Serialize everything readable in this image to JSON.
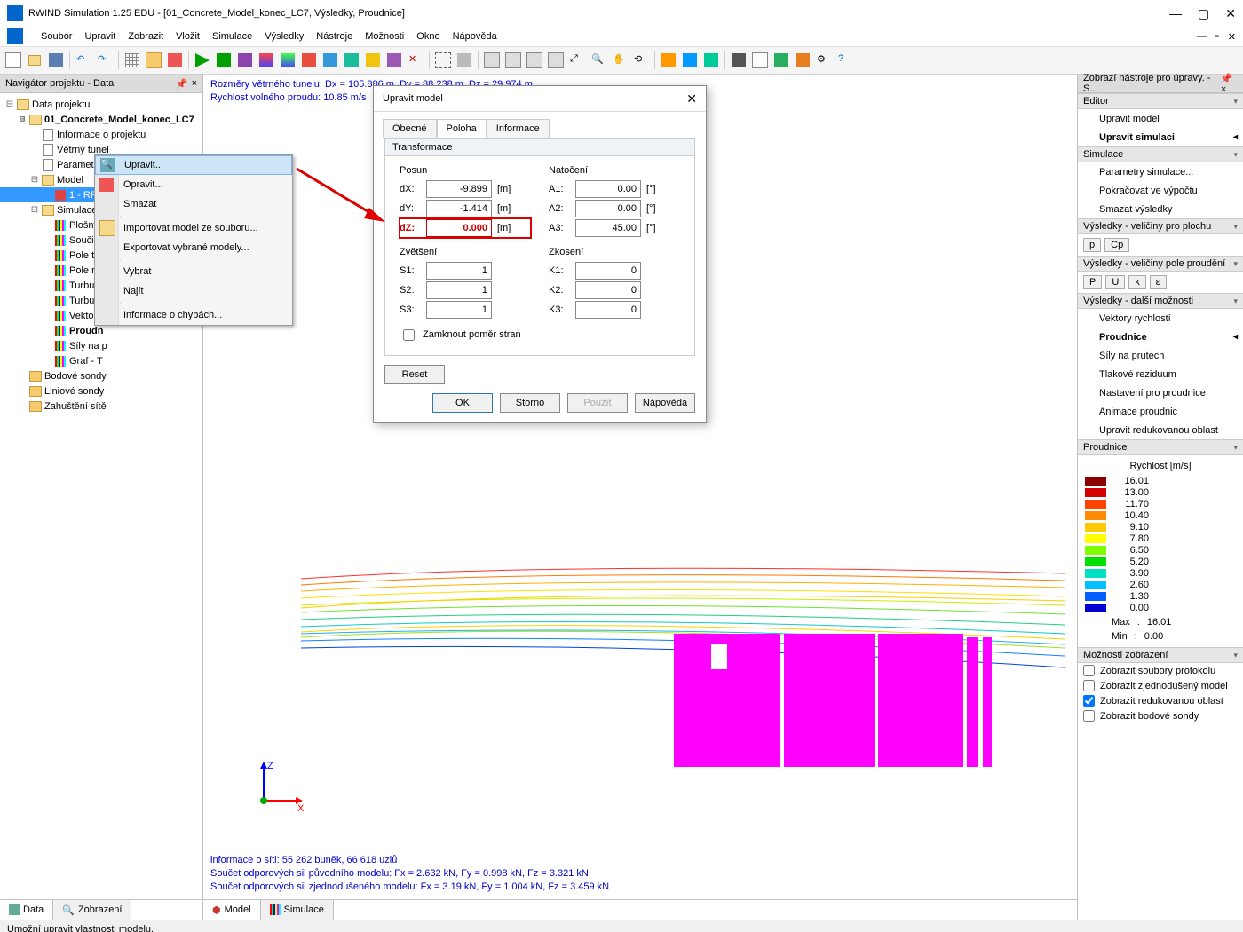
{
  "title": "RWIND Simulation 1.25 EDU - [01_Concrete_Model_konec_LC7, Výsledky, Proudnice]",
  "menu": [
    "Soubor",
    "Upravit",
    "Zobrazit",
    "Vložit",
    "Simulace",
    "Výsledky",
    "Nástroje",
    "Možnosti",
    "Okno",
    "Nápověda"
  ],
  "leftPanel": {
    "title": "Navigátor projektu - Data"
  },
  "tree": {
    "root": "Data projektu",
    "project": "01_Concrete_Model_konec_LC7",
    "items": [
      "Informace o projektu",
      "Větrný tunel",
      "Parametry simulace"
    ],
    "model": "Model",
    "modelSel": "1 - RFE",
    "sim": "Simulace",
    "simItems": [
      "Plošný r",
      "Součinit",
      "Pole tla",
      "Pole ryc",
      "Turbule",
      "Turbule",
      "Vektory",
      "Proudn",
      "Síly na p",
      "Graf - T"
    ],
    "tail": [
      "Bodové sondy",
      "Liniové sondy",
      "Zahuštění sítě"
    ]
  },
  "leftTabs": [
    "Data",
    "Zobrazení"
  ],
  "ctx": [
    "Upravit...",
    "Opravit...",
    "Smazat",
    "Importovat model ze souboru...",
    "Exportovat vybrané modely...",
    "Vybrat",
    "Najít",
    "Informace o chybách..."
  ],
  "dlg": {
    "title": "Upravit model",
    "tabs": [
      "Obecné",
      "Poloha",
      "Informace"
    ],
    "group": "Transformace",
    "posun": "Posun",
    "natoceni": "Natočení",
    "zvetseni": "Zvětšení",
    "zkoseni": "Zkosení",
    "dx": "-9.899",
    "dy": "-1.414",
    "dz": "0.000",
    "a1": "0.00",
    "a2": "0.00",
    "a3": "45.00",
    "s1": "1",
    "s2": "1",
    "s3": "1",
    "k1": "0",
    "k2": "0",
    "k3": "0",
    "lock": "Zamknout poměr stran",
    "reset": "Reset",
    "ok": "OK",
    "storno": "Storno",
    "pouzit": "Použít",
    "napoveda": "Nápověda"
  },
  "infoTop1": "Rozměry větrného tunelu: Dx = 105.886 m, Dy = 88.238 m, Dz = 29.974 m",
  "infoTop2": "Rychlost volného proudu: 10.85 m/s",
  "infoBot1": "informace o síti: 55 262 buněk, 66 618 uzlů",
  "infoBot2": "Součet odporových sil původního modelu: Fx = 2.632 kN, Fy = 0.998 kN, Fz = 3.321 kN",
  "infoBot3": "Součet odporových sil zjednodušeného modelu: Fx = 3.19 kN, Fy = 1.004 kN, Fz = 3.459 kN",
  "centerTabs": [
    "Model",
    "Simulace"
  ],
  "right": {
    "title": "Zobrazí nástroje pro úpravy. - S...",
    "sects": {
      "editor": "Editor",
      "editorItems": [
        "Upravit model",
        "Upravit simulaci"
      ],
      "sim": "Simulace",
      "simItems": [
        "Parametry simulace...",
        "Pokračovat ve výpočtu",
        "Smazat výsledky"
      ],
      "vp": "Výsledky - veličiny pro plochu",
      "vpp": "Výsledky - veličiny pole proudění",
      "dm": "Výsledky - další možnosti",
      "dmItems": [
        "Vektory rychlostí",
        "Proudnice",
        "Síly na prutech",
        "Tlakové reziduum",
        "Nastavení pro proudnice",
        "Animace proudnic",
        "Upravit redukovanou oblast"
      ],
      "pr": "Proudnice",
      "mz": "Možnosti zobrazení",
      "mzItems": [
        "Zobrazit soubory protokolu",
        "Zobrazit zjednodušený model",
        "Zobrazit redukovanou oblast",
        "Zobrazit bodové sondy"
      ]
    },
    "legend": {
      "title": "Rychlost [m/s]",
      "vals": [
        "16.01",
        "13.00",
        "11.70",
        "10.40",
        "9.10",
        "7.80",
        "6.50",
        "5.20",
        "3.90",
        "2.60",
        "1.30",
        "0.00"
      ],
      "colors": [
        "#8b0000",
        "#d40000",
        "#ff4500",
        "#ff8c00",
        "#ffc800",
        "#ffff00",
        "#80ff00",
        "#00e000",
        "#00e0c0",
        "#00c0ff",
        "#0060ff",
        "#0000d0"
      ],
      "max": "16.01",
      "min": "0.00"
    },
    "btns1": [
      "p",
      "Cp"
    ],
    "btns2": [
      "P",
      "U",
      "k",
      "ε"
    ]
  },
  "status": "Umožní upravit vlastnosti modelu."
}
